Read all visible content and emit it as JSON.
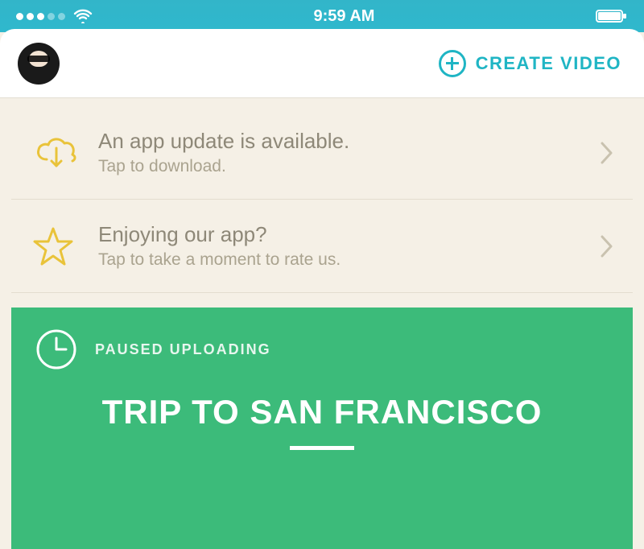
{
  "status_bar": {
    "time": "9:59 AM"
  },
  "header": {
    "create_label": "CREATE VIDEO"
  },
  "notices": [
    {
      "title": "An app update is available.",
      "subtitle": "Tap to download."
    },
    {
      "title": "Enjoying our app?",
      "subtitle": "Tap to take a moment to rate us."
    }
  ],
  "upload": {
    "status": "PAUSED UPLOADING",
    "title": "TRIP TO SAN FRANCISCO"
  },
  "colors": {
    "accent_teal": "#1fb5c4",
    "accent_yellow": "#e9c33a",
    "card_green": "#3cbb7a"
  }
}
